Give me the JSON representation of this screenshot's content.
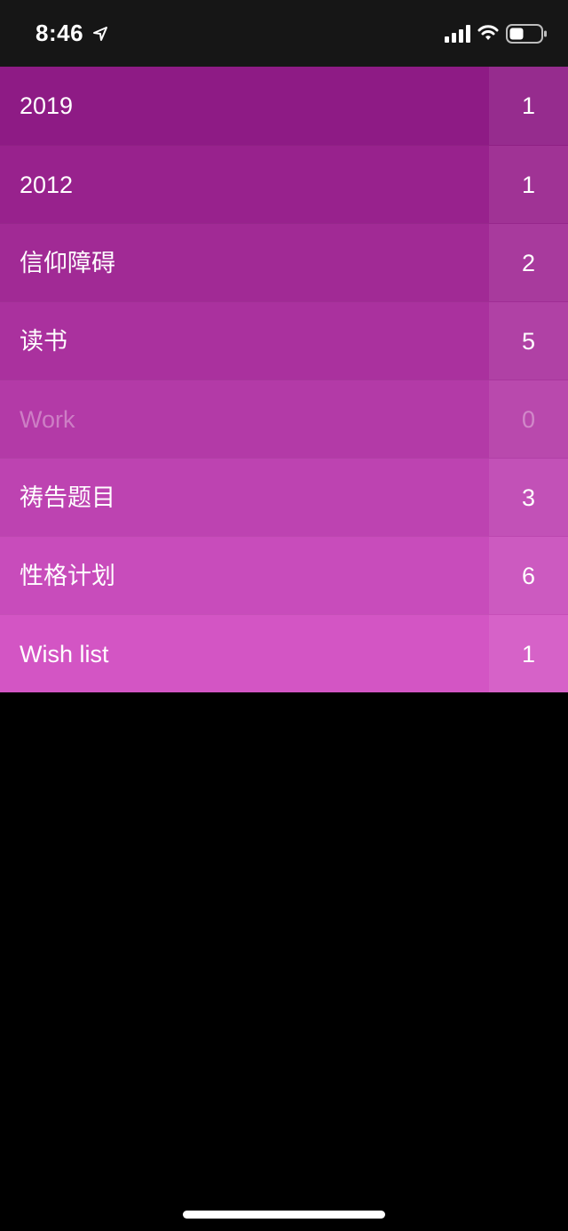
{
  "status_bar": {
    "time": "8:46",
    "icons": [
      "location-arrow-icon",
      "cellular-signal-icon",
      "wifi-icon",
      "battery-icon"
    ]
  },
  "lists": [
    {
      "label": "2019",
      "count": "1",
      "color": "#8e1b85"
    },
    {
      "label": "2012",
      "count": "1",
      "color": "#98228d"
    },
    {
      "label": "信仰障碍",
      "count": "2",
      "color": "#a12a95"
    },
    {
      "label": "读书",
      "count": "5",
      "color": "#aa319e"
    },
    {
      "label": "Work",
      "count": "0",
      "color": "#b33aa7",
      "dimmed": true
    },
    {
      "label": "祷告题目",
      "count": "3",
      "color": "#bd43b1"
    },
    {
      "label": "性格计划",
      "count": "6",
      "color": "#c84cbb"
    },
    {
      "label": "Wish list",
      "count": "1",
      "color": "#d355c4"
    }
  ],
  "colors": {
    "status_bar_bg": "#161616",
    "background": "#000000",
    "text": "#ffffff"
  }
}
